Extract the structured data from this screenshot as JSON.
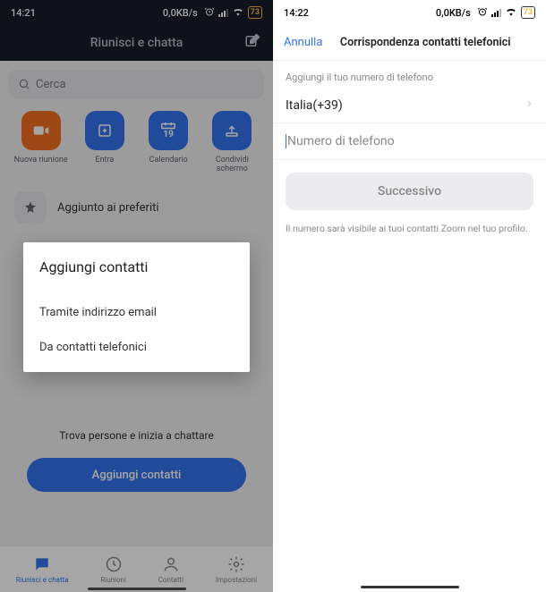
{
  "left": {
    "status": {
      "time": "14:21",
      "speed": "0,0KB/s",
      "battery": "73"
    },
    "header_title": "Riunisci e chatta",
    "search_placeholder": "Cerca",
    "actions": {
      "new_meeting": "Nuova riunione",
      "join": "Entra",
      "calendar": "Calendario",
      "calendar_day": "19",
      "share": "Condividi schermo"
    },
    "favorites_label": "Aggiunto ai preferiti",
    "find_people": "Trova persone e inizia a chattare",
    "add_contacts_btn": "Aggiungi contatti",
    "sheet": {
      "title": "Aggiungi contatti",
      "by_email": "Tramite indirizzo email",
      "by_phone": "Da contatti telefonici"
    },
    "tabs": {
      "chat": "Riunisci e chatta",
      "meetings": "Riunioni",
      "contacts": "Contatti",
      "settings": "Impostazioni"
    }
  },
  "right": {
    "status": {
      "time": "14:22",
      "speed": "0,0KB/s",
      "battery": "73"
    },
    "cancel": "Annulla",
    "title": "Corrispondenza contatti telefonici",
    "section_label": "Aggiungi il tuo numero di telefono",
    "country": "Italia(+39)",
    "phone_placeholder": "Numero di telefono",
    "next": "Successivo",
    "note": "Il numero sarà visibile ai tuoi contatti Zoom nel tuo profilo."
  }
}
